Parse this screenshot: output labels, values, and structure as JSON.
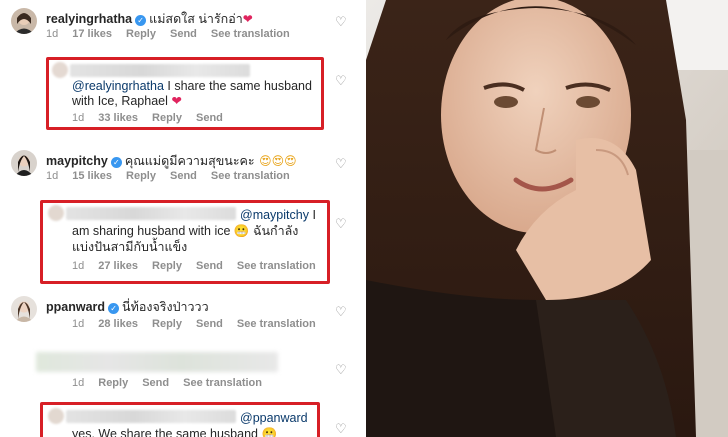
{
  "comments": [
    {
      "username": "realyingrhatha",
      "text": "แม่สดใส น่ารักอ่า",
      "meta": {
        "time": "1d",
        "likes": "17 likes",
        "reply": "Reply",
        "send": "Send",
        "translation": "See translation"
      }
    },
    {
      "mention": "@realyingrhatha",
      "text_line1": "I share the same husband",
      "text_line2": "with Ice, Raphael",
      "meta": {
        "time": "1d",
        "likes": "33 likes",
        "reply": "Reply",
        "send": "Send"
      }
    },
    {
      "username": "maypitchy",
      "text": "คุณแม่ดูมีความสุขนะคะ",
      "meta": {
        "time": "1d",
        "likes": "15 likes",
        "reply": "Reply",
        "send": "Send",
        "translation": "See translation"
      }
    },
    {
      "mention": "@maypitchy",
      "text_line1_suffix": "I",
      "text_line2": "am sharing husband with ice",
      "text_line2_thai": "ฉันกำลัง",
      "text_line3": "แบ่งปันสามีกับน้ำแข็ง",
      "meta": {
        "time": "1d",
        "likes": "27 likes",
        "reply": "Reply",
        "send": "Send",
        "translation": "See translation"
      }
    },
    {
      "username": "ppanward",
      "text": "นี่ท้องจริงป่าววว",
      "meta": {
        "time": "1d",
        "likes": "28 likes",
        "reply": "Reply",
        "send": "Send",
        "translation": "See translation"
      }
    },
    {
      "meta": {
        "time": "1d",
        "reply": "Reply",
        "send": "Send",
        "translation": "See translation"
      }
    },
    {
      "mention": "@ppanward",
      "text_line2": "yes. We share the same husband"
    }
  ],
  "colors": {
    "highlight": "#d71f26",
    "verified": "#3897f0",
    "meta": "#8e8e8e"
  },
  "icons": [
    "heart-outline-icon",
    "verified-badge-icon",
    "red-heart-emoji",
    "smiling-face-heart-eyes-emoji",
    "grimacing-face-emoji"
  ]
}
